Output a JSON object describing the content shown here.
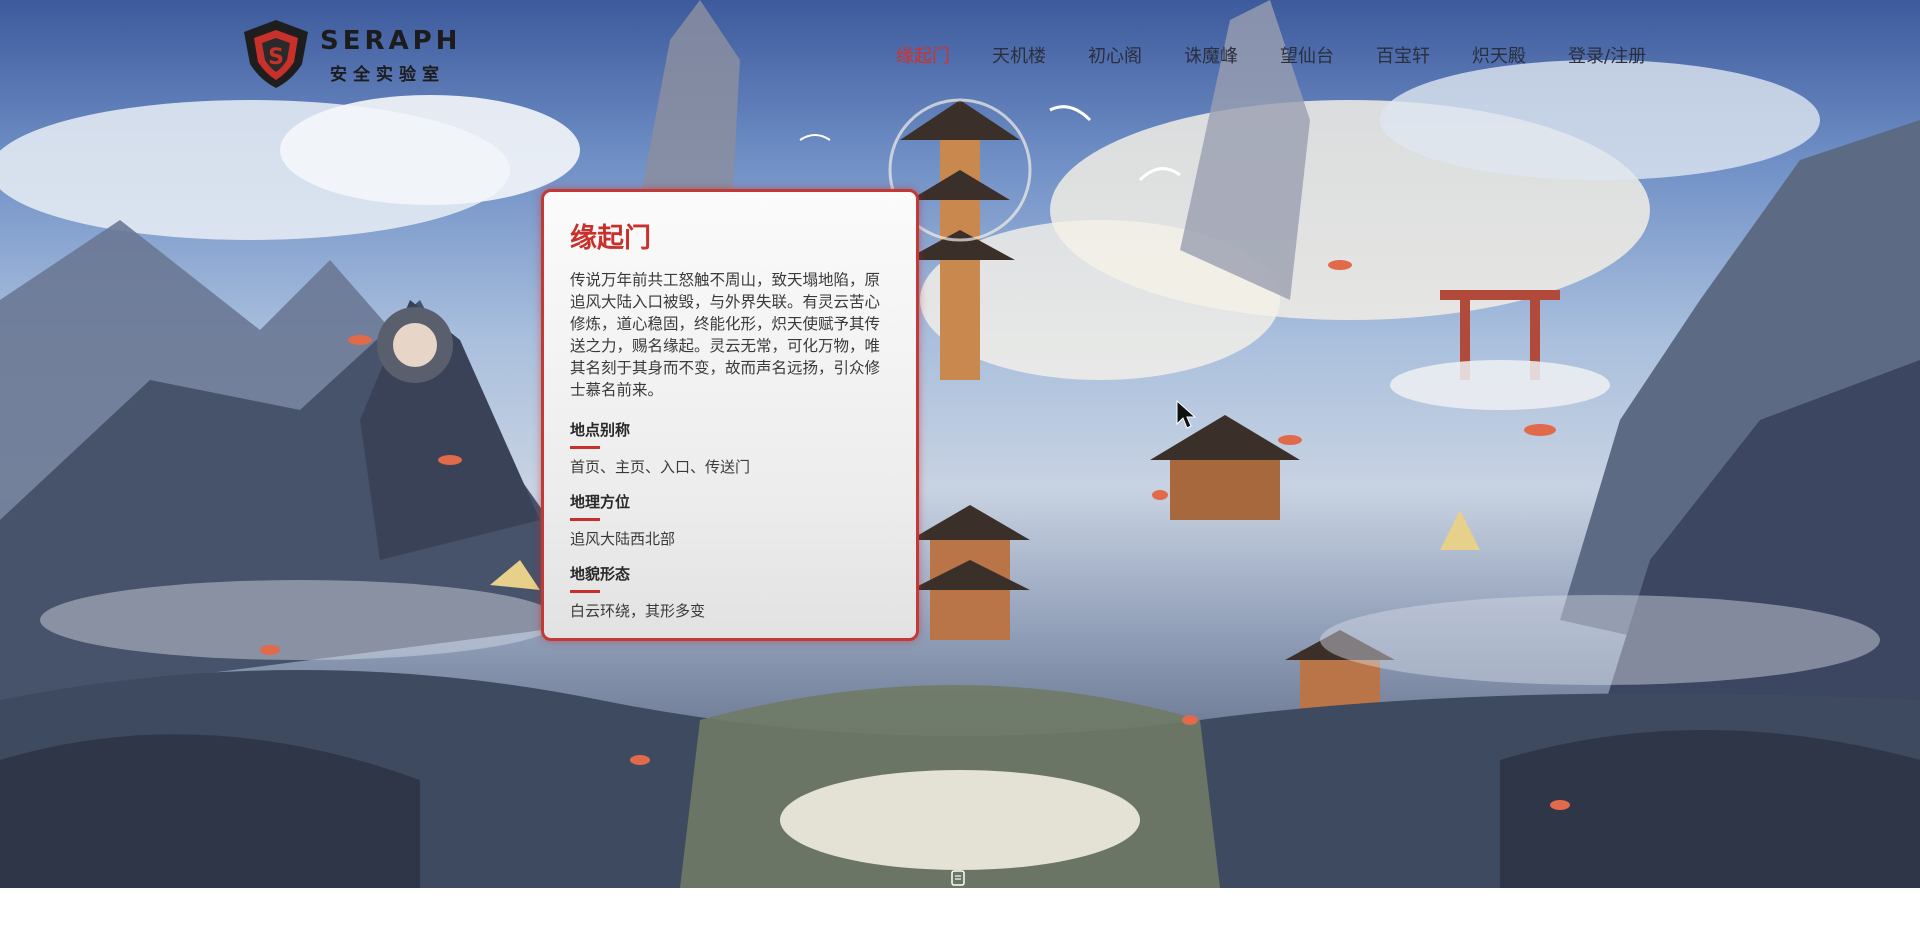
{
  "brand": {
    "name": "SERAPH",
    "subtitle": "安全实验室"
  },
  "nav": {
    "items": [
      {
        "label": "缘起门",
        "active": true
      },
      {
        "label": "天机楼",
        "active": false
      },
      {
        "label": "初心阁",
        "active": false
      },
      {
        "label": "诛魔峰",
        "active": false
      },
      {
        "label": "望仙台",
        "active": false
      },
      {
        "label": "百宝轩",
        "active": false
      },
      {
        "label": "炽天殿",
        "active": false
      },
      {
        "label": "登录/注册",
        "active": false
      }
    ]
  },
  "card": {
    "title": "缘起门",
    "description": "传说万年前共工怒触不周山，致天塌地陷，原追风大陆入口被毁，与外界失联。有灵云苦心修炼，道心稳固，终能化形，炽天使赋予其传送之力，赐名缘起。灵云无常，可化万物，唯其名刻于其身而不变，故而声名远扬，引众修士慕名前来。",
    "fields": [
      {
        "label": "地点别称",
        "value": "首页、主页、入口、传送门"
      },
      {
        "label": "地理方位",
        "value": "追风大陆西北部"
      },
      {
        "label": "地貌形态",
        "value": "白云环绕，其形多变"
      }
    ]
  },
  "colors": {
    "accent": "#c8302c",
    "nav_text": "#2a2f3d",
    "sky_top": "#3d5a9c"
  },
  "icons": {
    "logo": "shield-logo-icon",
    "cursor": "mouse-pointer-icon",
    "scroll": "scroll-down-icon"
  }
}
